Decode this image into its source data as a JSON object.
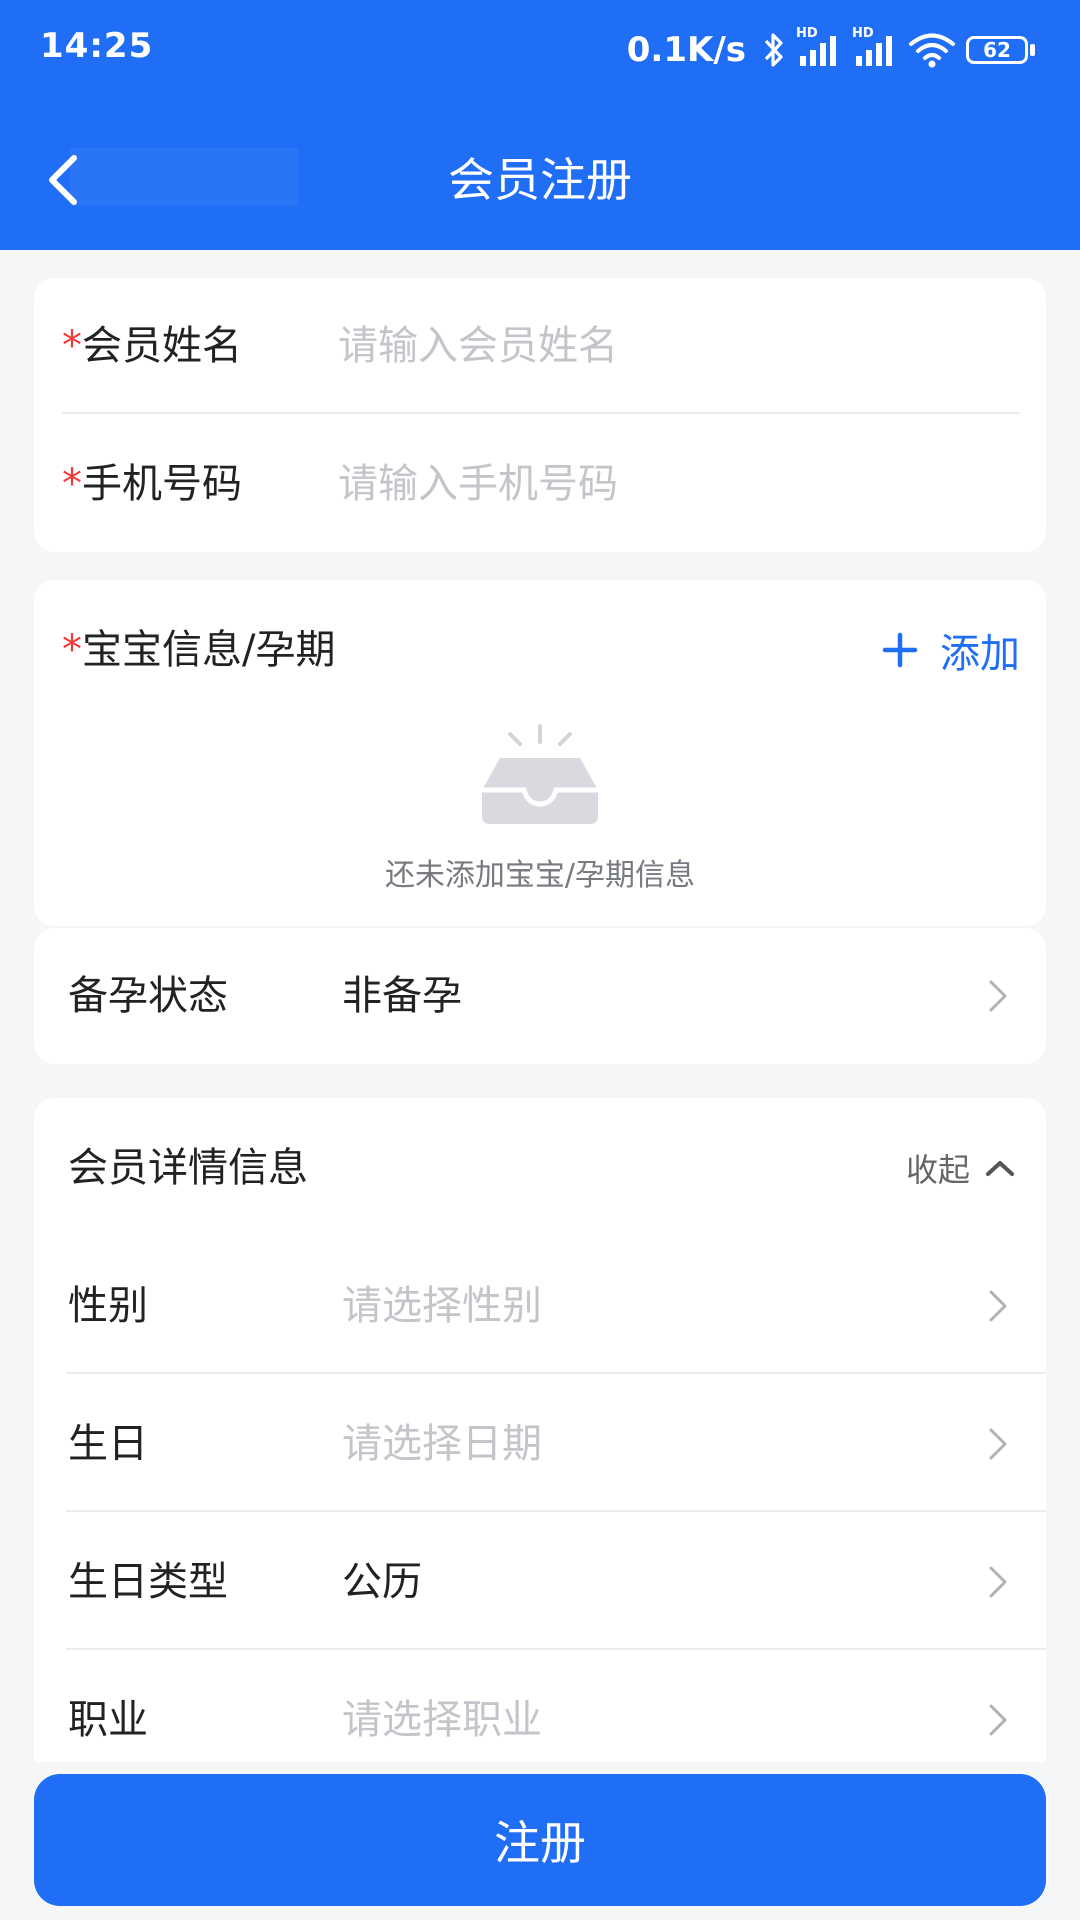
{
  "status_bar": {
    "time": "14:25",
    "net_speed": "0.1K/s",
    "signal_1_label": "HD",
    "signal_2_label": "HD",
    "battery_level": "62"
  },
  "nav": {
    "title": "会员注册"
  },
  "basic_form": {
    "name": {
      "label": "会员姓名",
      "placeholder": "请输入会员姓名",
      "required_mark": "*"
    },
    "phone": {
      "label": "手机号码",
      "placeholder": "请输入手机号码",
      "required_mark": "*"
    }
  },
  "baby_section": {
    "required_mark": "*",
    "title": "宝宝信息/孕期",
    "add_label": "添加",
    "empty_text": "还未添加宝宝/孕期信息"
  },
  "pregnancy_prep": {
    "label": "备孕状态",
    "value": "非备孕"
  },
  "details_section": {
    "title": "会员详情信息",
    "collapse_label": "收起",
    "fields": [
      {
        "label": "性别",
        "placeholder": "请选择性别"
      },
      {
        "label": "生日",
        "placeholder": "请选择日期"
      },
      {
        "label": "生日类型",
        "value": "公历"
      },
      {
        "label": "职业",
        "placeholder": "请选择职业"
      }
    ]
  },
  "register_button": "注册",
  "colors": {
    "primary": "#1f6ef5",
    "required": "#ee3a3a",
    "placeholder": "#c3c5ca",
    "background": "#f5f6f8"
  },
  "icons": [
    "back-arrow-icon",
    "bluetooth-icon",
    "signal-icon",
    "wifi-icon",
    "battery-icon",
    "plus-icon",
    "empty-inbox-icon",
    "chevron-right-icon",
    "chevron-up-icon"
  ]
}
